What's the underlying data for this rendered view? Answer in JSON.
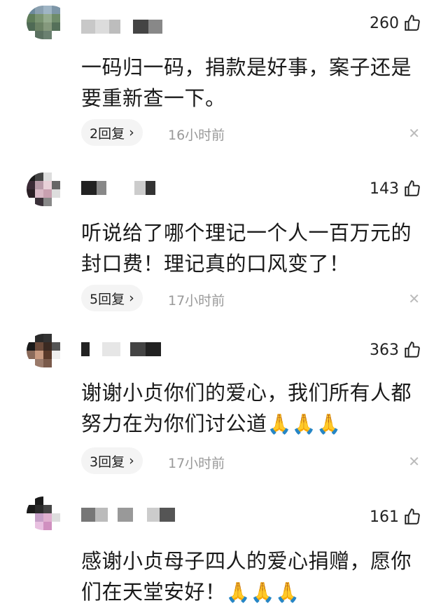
{
  "comments": [
    {
      "likes": "260",
      "text": "一码归一码，捐款是好事，案子还是要重新查一下。",
      "replies": "2回复",
      "time": "16小时前",
      "emoji": ""
    },
    {
      "likes": "143",
      "text": "听说给了哪个理记一个人一百万元的封口费！理记真的口风变了！",
      "replies": "5回复",
      "time": "17小时前",
      "emoji": ""
    },
    {
      "likes": "363",
      "text": "谢谢小贞你们的爱心，我们所有人都努力在为你们讨公道",
      "replies": "3回复",
      "time": "17小时前",
      "emoji": "🙏🙏🙏"
    },
    {
      "likes": "161",
      "text": "感谢小贞母子四人的爱心捐赠，愿你们在天堂安好！",
      "replies": "",
      "time": "",
      "emoji": "🙏🙏🙏"
    }
  ],
  "icons": {
    "like": "thumb-up-icon",
    "chevron": "chevron-right-icon",
    "close": "close-icon"
  },
  "ui": {
    "chevron_glyph": "›",
    "close_glyph": "✕"
  }
}
